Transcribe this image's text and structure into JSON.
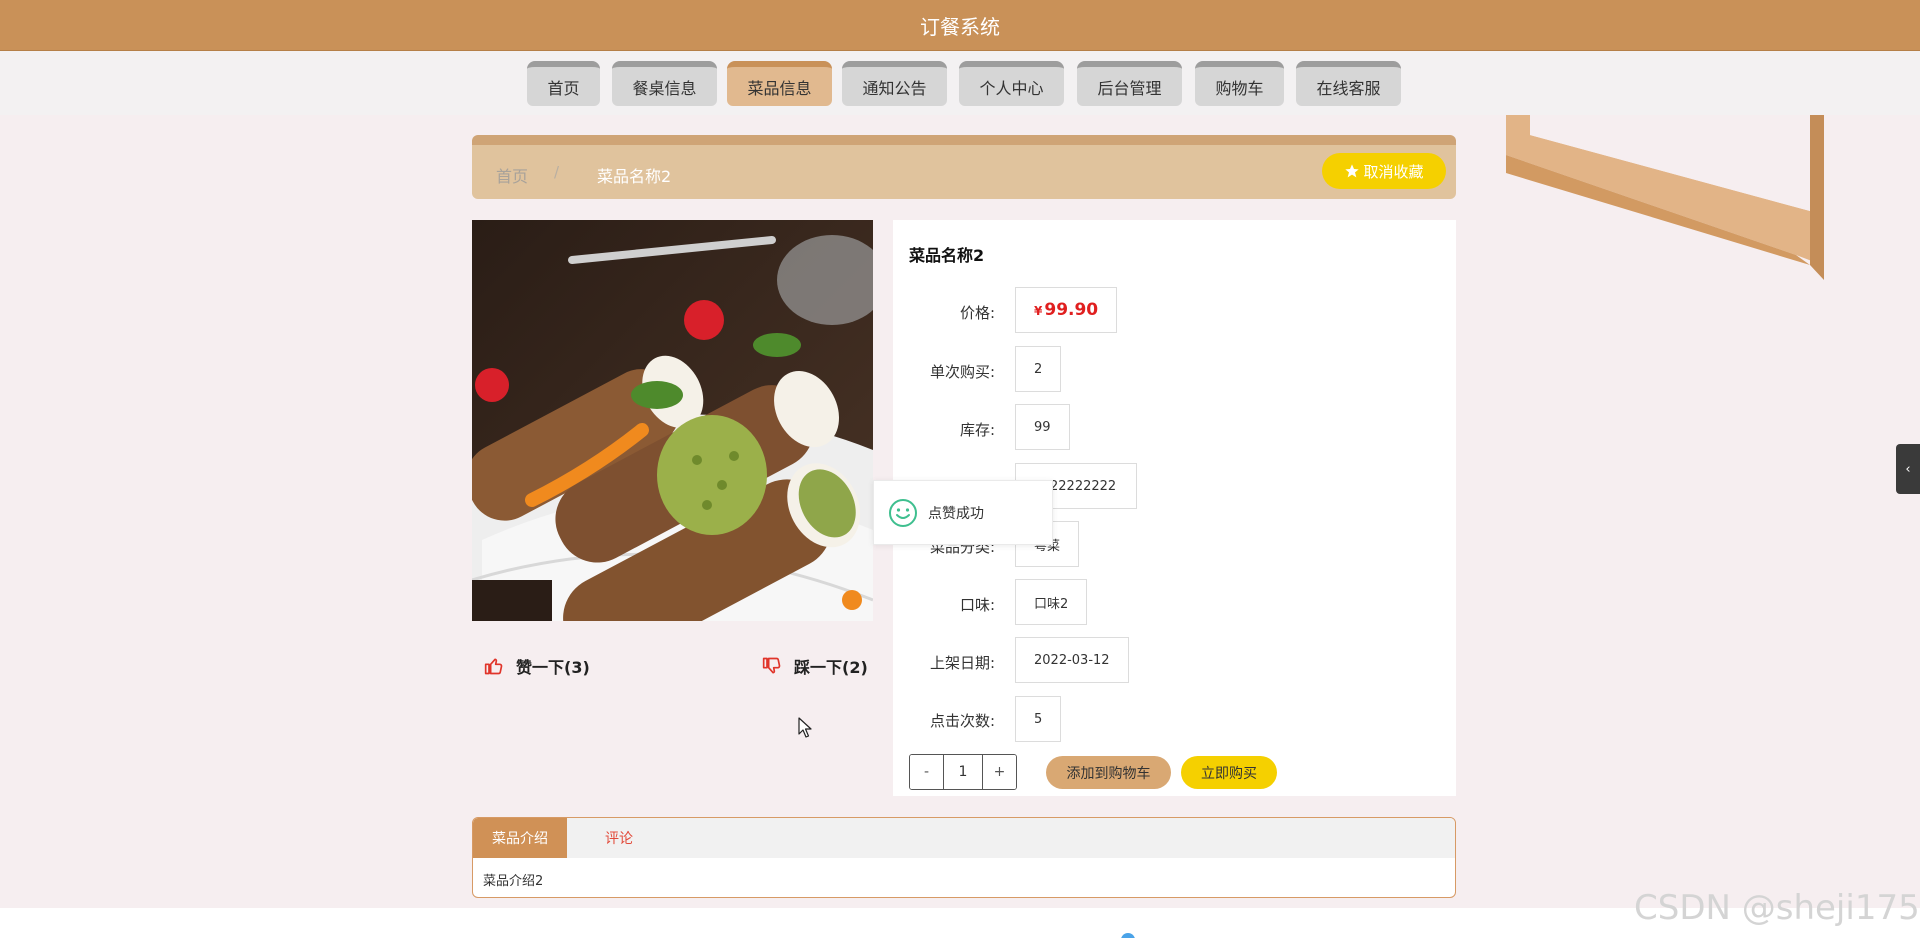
{
  "app": {
    "title": "订餐系统"
  },
  "nav": {
    "items": [
      {
        "label": "首页"
      },
      {
        "label": "餐桌信息"
      },
      {
        "label": "菜品信息"
      },
      {
        "label": "通知公告"
      },
      {
        "label": "个人中心"
      },
      {
        "label": "后台管理"
      },
      {
        "label": "购物车"
      },
      {
        "label": "在线客服"
      }
    ],
    "active": "菜品信息"
  },
  "breadcrumb": {
    "home": "首页",
    "separator": "/",
    "current": "菜品名称2"
  },
  "favorite_button": {
    "icon": "star-icon",
    "label": "取消收藏"
  },
  "dish": {
    "name": "菜品名称2",
    "fields": {
      "price": {
        "label": "价格:",
        "currency": "¥",
        "value": "99.90"
      },
      "single_purchase": {
        "label": "单次购买:",
        "value": "2"
      },
      "stock": {
        "label": "库存:",
        "value": "99"
      },
      "code": {
        "value": "22222222"
      },
      "category": {
        "label": "菜品分类:",
        "value": "粤菜"
      },
      "flavor": {
        "label": "口味:",
        "value": "口味2"
      },
      "listing_date": {
        "label": "上架日期:",
        "value": "2022-03-12"
      },
      "click_count": {
        "label": "点击次数:",
        "value": "5"
      }
    }
  },
  "votes": {
    "like": {
      "icon": "thumbs-up-icon",
      "label": "赞一下(3)"
    },
    "dislike": {
      "icon": "thumbs-down-icon",
      "label": "踩一下(2)"
    }
  },
  "quantity": {
    "minus": "-",
    "value": "1",
    "plus": "+"
  },
  "actions": {
    "add_to_cart": "添加到购物车",
    "buy_now": "立即购买"
  },
  "toast": {
    "icon": "smile-icon",
    "message": "点赞成功"
  },
  "tabs": {
    "items": [
      {
        "label": "菜品介绍"
      },
      {
        "label": "评论"
      }
    ],
    "active": "菜品介绍",
    "content": "菜品介绍2"
  },
  "side_tab": {
    "icon": "chevron-left-icon",
    "glyph": "‹"
  },
  "watermark": "CSDN @sheji175",
  "colors": {
    "topbar": "#c99158",
    "accent": "#d09156",
    "price": "#e01f1f",
    "yellow_button": "#f5d000"
  }
}
